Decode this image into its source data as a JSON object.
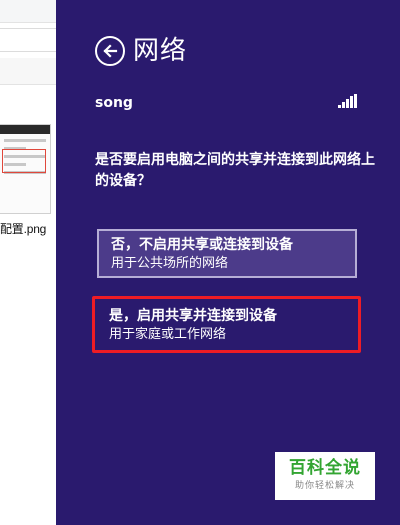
{
  "explorer": {
    "filename": "配置.png"
  },
  "charm": {
    "title": "网络",
    "network_name": "song",
    "question": "是否要启用电脑之间的共享并连接到此网络上的设备？",
    "options": [
      {
        "main": "否，不启用共享或连接到设备",
        "sub": "用于公共场所的网络"
      },
      {
        "main": "是，启用共享并连接到设备",
        "sub": "用于家庭或工作网络"
      }
    ],
    "signal_icon": "wifi-signal-full-icon",
    "back_icon": "back-arrow-icon",
    "background_color": "#2a1a6e",
    "highlight_color": "#ee1c25"
  },
  "watermark": {
    "main": "百科全说",
    "sub": "助你轻松解决",
    "color": "#33a532"
  }
}
